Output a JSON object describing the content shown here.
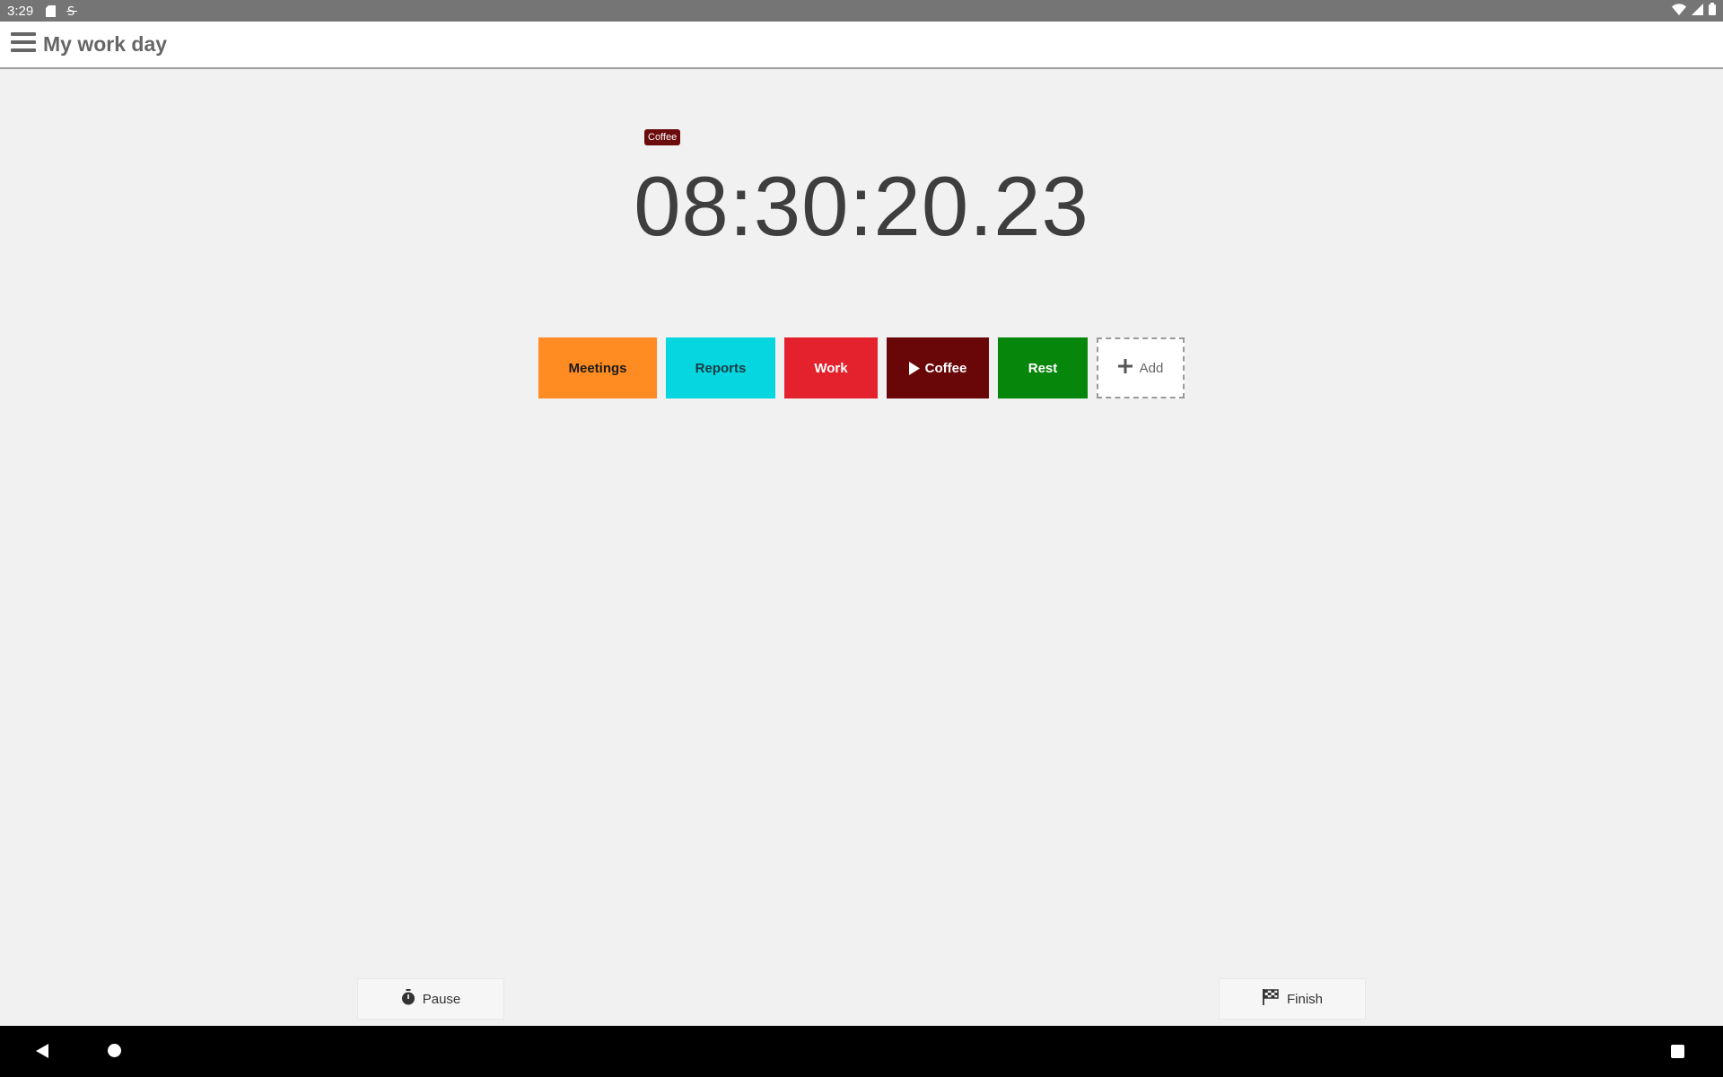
{
  "status_bar": {
    "time": "3:29",
    "icons": [
      "sd-card-icon",
      "sync-icon",
      "wifi-icon",
      "signal-icon",
      "battery-icon"
    ]
  },
  "app_bar": {
    "title": "My work day",
    "menu_icon": "hamburger-menu-icon"
  },
  "timer": {
    "current_activity": "Coffee",
    "current_activity_color": "#6b0b0b",
    "elapsed": "08:30:20.23"
  },
  "activities": [
    {
      "label": "Meetings",
      "color": "#ff8c22",
      "text_color": "#1a1a1a",
      "active": false
    },
    {
      "label": "Reports",
      "color": "#06d6e0",
      "text_color": "#1a3a40",
      "active": false
    },
    {
      "label": "Work",
      "color": "#e3222d",
      "text_color": "#ffffff",
      "active": false
    },
    {
      "label": "Coffee",
      "color": "#690708",
      "text_color": "#ffffff",
      "active": true
    },
    {
      "label": "Rest",
      "color": "#06860b",
      "text_color": "#ffffff",
      "active": false
    }
  ],
  "add_button": {
    "label": "Add",
    "icon": "plus-icon"
  },
  "bottom_actions": {
    "pause_label": "Pause",
    "pause_icon": "stopwatch-icon",
    "finish_label": "Finish",
    "finish_icon": "checkered-flag-icon"
  },
  "nav_bar": {
    "icons": [
      "back-icon",
      "home-icon",
      "recents-icon"
    ]
  }
}
